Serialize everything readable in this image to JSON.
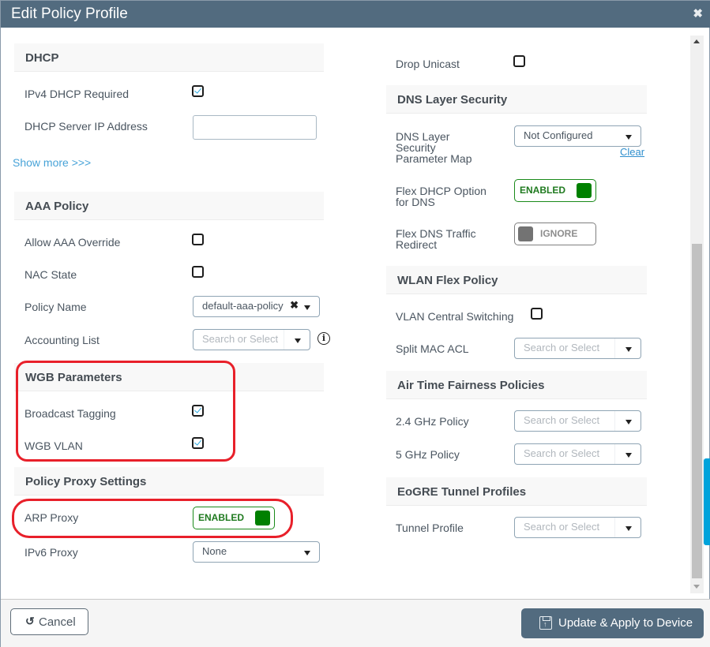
{
  "header": {
    "title": "Edit Policy Profile",
    "close_icon": "close-icon"
  },
  "left": {
    "dhcp": {
      "title": "DHCP",
      "ipv4_required": {
        "label": "IPv4 DHCP Required",
        "checked": true
      },
      "server_ip": {
        "label": "DHCP Server IP Address",
        "value": ""
      },
      "show_more": "Show more >>>"
    },
    "aaa": {
      "title": "AAA Policy",
      "allow_override": {
        "label": "Allow AAA Override",
        "checked": false
      },
      "nac_state": {
        "label": "NAC State",
        "checked": false
      },
      "policy_name": {
        "label": "Policy Name",
        "value": "default-aaa-policy"
      },
      "accounting_list": {
        "label": "Accounting List",
        "placeholder": "Search or Select"
      }
    },
    "wgb": {
      "title": "WGB Parameters",
      "broadcast_tagging": {
        "label": "Broadcast Tagging",
        "checked": true
      },
      "wgb_vlan": {
        "label": "WGB VLAN",
        "checked": true
      }
    },
    "proxy": {
      "title": "Policy Proxy Settings",
      "arp_proxy": {
        "label": "ARP Proxy",
        "state": "ENABLED"
      },
      "ipv6_proxy": {
        "label": "IPv6 Proxy",
        "value": "None"
      }
    }
  },
  "right": {
    "drop_unicast": {
      "label": "Drop Unicast",
      "checked": false
    },
    "dns": {
      "title": "DNS Layer Security",
      "param_map": {
        "label_lines": [
          "DNS Layer",
          "Security",
          "Parameter Map"
        ],
        "value": "Not Configured",
        "clear": "Clear"
      },
      "flex_dhcp": {
        "label_lines": [
          "Flex DHCP Option",
          "for DNS"
        ],
        "state": "ENABLED"
      },
      "flex_dns_redirect": {
        "label_lines": [
          "Flex DNS Traffic",
          "Redirect"
        ],
        "state": "IGNORE"
      }
    },
    "wlan_flex": {
      "title": "WLAN Flex Policy",
      "vlan_central": {
        "label": "VLAN Central Switching",
        "checked": false
      },
      "split_mac_acl": {
        "label": "Split MAC ACL",
        "placeholder": "Search or Select"
      }
    },
    "atf": {
      "title": "Air Time Fairness Policies",
      "ghz24": {
        "label": "2.4 GHz Policy",
        "placeholder": "Search or Select"
      },
      "ghz5": {
        "label": "5 GHz Policy",
        "placeholder": "Search or Select"
      }
    },
    "eogre": {
      "title": "EoGRE Tunnel Profiles",
      "tunnel_profile": {
        "label": "Tunnel Profile",
        "placeholder": "Search or Select"
      }
    }
  },
  "footer": {
    "cancel_label": "Cancel",
    "apply_label": "Update & Apply to Device"
  },
  "colors": {
    "header": "#526b7f",
    "enabled": "#008000",
    "annotation": "#e8202a",
    "link": "#48a3d8"
  }
}
